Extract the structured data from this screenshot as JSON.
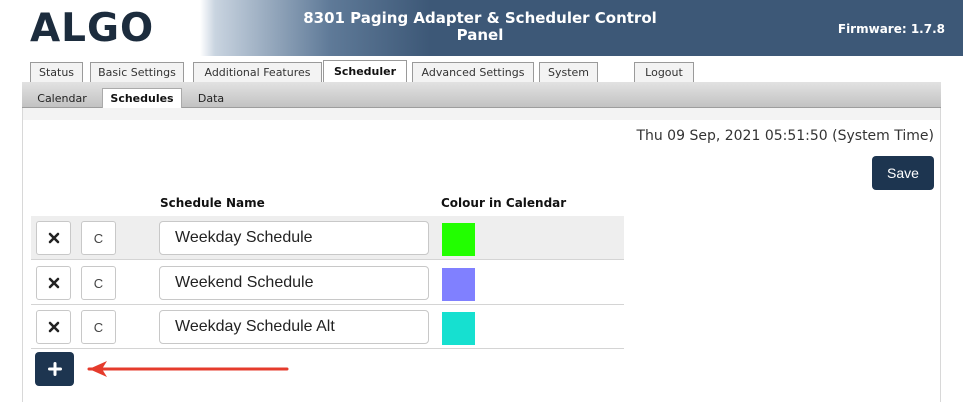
{
  "header": {
    "logo": "ALGO",
    "title": "8301 Paging Adapter & Scheduler Control Panel",
    "firmware": "Firmware: 1.7.8"
  },
  "tabs": [
    {
      "label": "Status"
    },
    {
      "label": "Basic Settings"
    },
    {
      "label": "Additional Features"
    },
    {
      "label": "Scheduler",
      "active": true
    },
    {
      "label": "Advanced Settings"
    },
    {
      "label": "System"
    },
    {
      "label": "Logout"
    }
  ],
  "subtabs": [
    {
      "label": "Calendar"
    },
    {
      "label": "Schedules",
      "active": true
    },
    {
      "label": "Data"
    }
  ],
  "system_time": "Thu 09 Sep, 2021 05:51:50 (System Time)",
  "save_label": "Save",
  "columns": {
    "name": "Schedule Name",
    "colour": "Colour in Calendar"
  },
  "schedules": [
    {
      "name": "Weekday Schedule",
      "copy_label": "C",
      "colour": "#22ff00"
    },
    {
      "name": "Weekend Schedule",
      "copy_label": "C",
      "colour": "#8080ff"
    },
    {
      "name": "Weekday Schedule Alt",
      "copy_label": "C",
      "colour": "#16e0d0"
    }
  ],
  "icons": {
    "delete": "close-icon",
    "add": "plus-icon",
    "annotation": "red-arrow-icon"
  },
  "colors": {
    "header_dark": "#3d5877",
    "button": "#1d3550",
    "annotation_arrow": "#e53b2c"
  }
}
